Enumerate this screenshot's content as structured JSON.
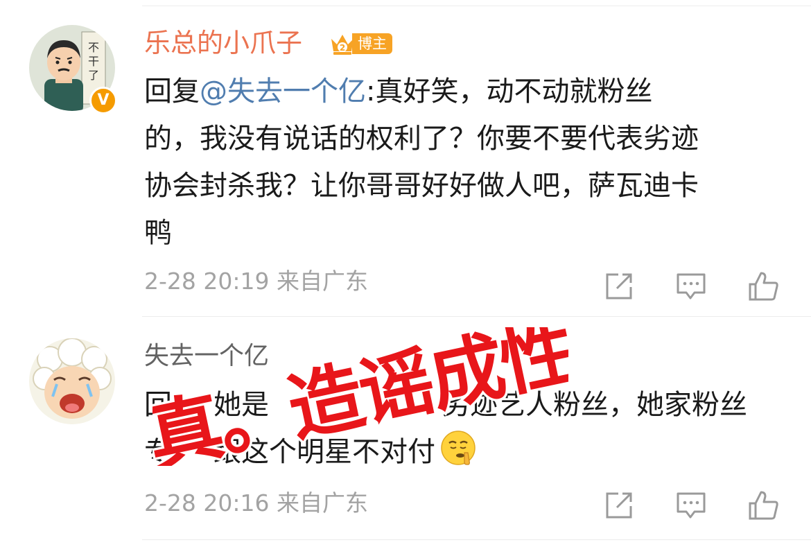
{
  "comments": [
    {
      "username": "乐总的小爪子",
      "badge_label": "博主",
      "verified_mark": "V",
      "reply_prefix": "回复",
      "mention": "@失去一个亿",
      "text_line1": ":真好笑，动不动就粉丝",
      "text_line2": "的，我没有说话的权利了？你要不要代表劣迹",
      "text_line3": "协会封杀我？让你哥哥好好做人吧，萨瓦迪卡",
      "text_line4": "鸭",
      "time": "2-28 20:19",
      "location": "来自广东",
      "icons": [
        "share-icon",
        "reply-icon",
        "like-icon"
      ]
    },
    {
      "username": "失去一个亿",
      "text_line1_start": "回",
      "text_line1_mid1": "她是",
      "text_line1_end": "劣迹艺人粉丝，她家粉丝",
      "text_line2_start": "专",
      "text_line2_end": "跟这个明星不对付",
      "emoji": "shush-emoji-icon",
      "time": "2-28 20:16",
      "location": "来自广东",
      "icons": [
        "share-icon",
        "reply-icon",
        "like-icon"
      ]
    }
  ],
  "stamp": {
    "text": "真。造谣成性",
    "color": "#e8161a"
  },
  "colors": {
    "username_vip": "#eb7350",
    "mention": "#507daf",
    "meta": "#a3a3a3",
    "badge": "#f7a325",
    "verified": "#f59b00"
  }
}
